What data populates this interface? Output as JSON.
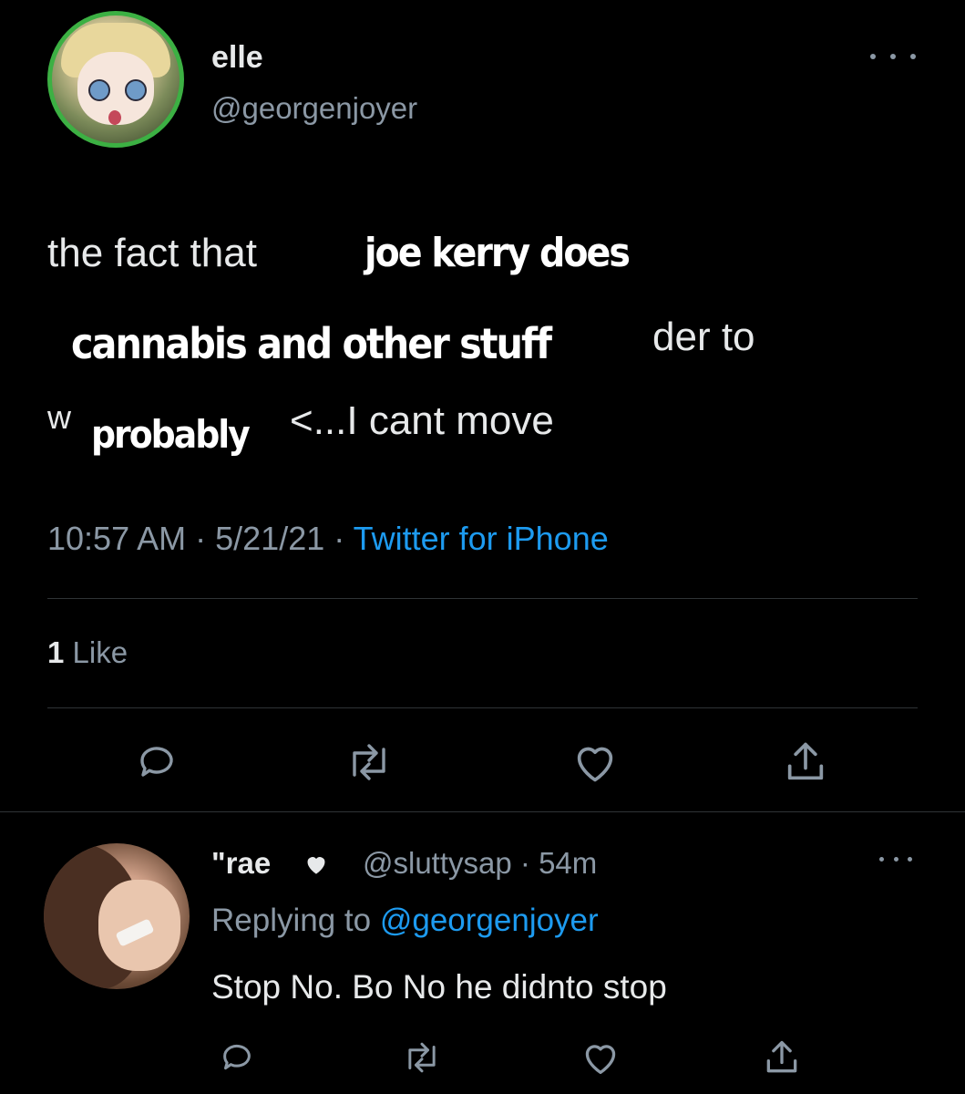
{
  "tweet": {
    "author": {
      "display_name": "elle",
      "handle": "@georgenjoyer"
    },
    "text_lines": {
      "l1_orig": "the fact that",
      "l1_overlay": "joe kerry does",
      "l2_overlay": "cannabis and other stuff",
      "l2_orig": "der to",
      "l3_orig_a": "w",
      "l3_overlay": "probably",
      "l3_orig_b": "<...I cant move"
    },
    "time": "10:57 AM",
    "date": "5/21/21",
    "source": "Twitter for iPhone",
    "likes_count": "1",
    "likes_label": "Like"
  },
  "reply": {
    "display_name": "\"rae",
    "handle": "@sluttysap",
    "age": "54m",
    "replying_label": "Replying to",
    "replying_to": "@georgenjoyer",
    "text": "Stop No. Bo No he didnto stop"
  },
  "icons": [
    "more-icon",
    "reply-icon",
    "retweet-icon",
    "like-icon",
    "share-icon",
    "heart-icon"
  ],
  "colors": {
    "background": "#000000",
    "text": "#e7e9ea",
    "muted": "#8b98a5",
    "link": "#1d9bf0",
    "avatar_ring": "#3cb043"
  }
}
